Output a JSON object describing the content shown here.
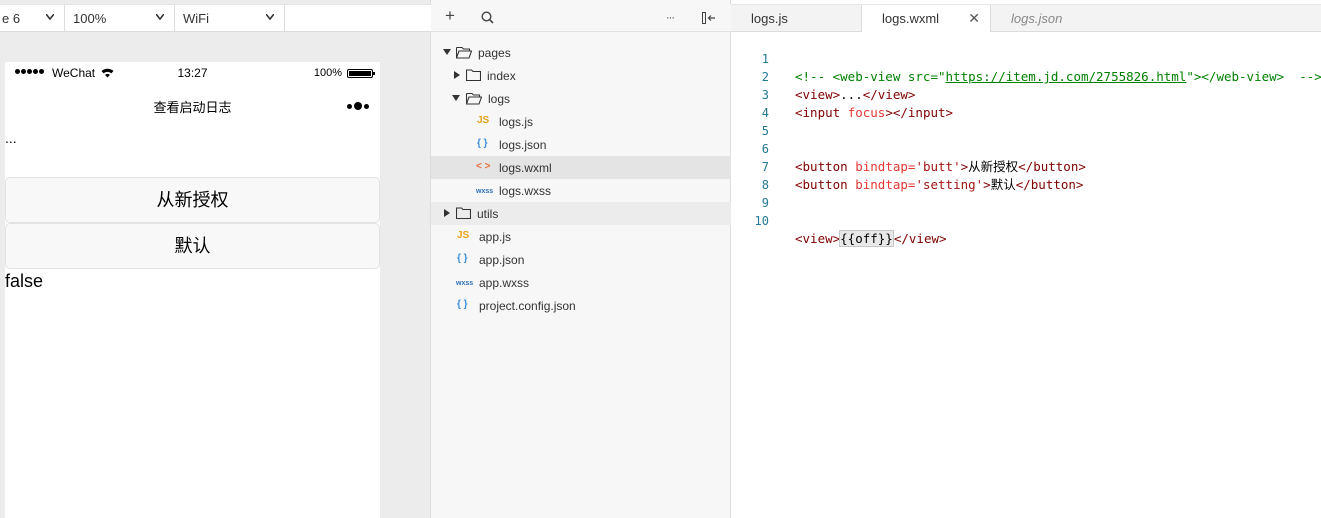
{
  "simulator": {
    "toolbar": {
      "device_select": "e 6",
      "zoom_select": "100%",
      "network_select": "WiFi"
    },
    "statusbar": {
      "carrier": "WeChat",
      "time": "13:27",
      "battery": "100%"
    },
    "navbar": {
      "title": "查看启动日志"
    },
    "page": {
      "ellipsis": "...",
      "reauth_button": "从新授权",
      "default_button": "默认",
      "off_value": "false"
    }
  },
  "file_tree": {
    "toolbar": {
      "add": "+",
      "more": "···"
    },
    "items": [
      {
        "label": "pages",
        "kind": "folder",
        "icon": "folder-open-icon"
      },
      {
        "label": "index",
        "kind": "folder",
        "icon": "folder-icon"
      },
      {
        "label": "logs",
        "kind": "folder",
        "icon": "folder-open-icon"
      },
      {
        "label": "logs.js",
        "kind": "file",
        "icon": "js-file-icon",
        "glyph": "JS"
      },
      {
        "label": "logs.json",
        "kind": "file",
        "icon": "json-file-icon",
        "glyph": "{ }"
      },
      {
        "label": "logs.wxml",
        "kind": "file",
        "icon": "wxml-file-icon",
        "glyph": "< >"
      },
      {
        "label": "logs.wxss",
        "kind": "file",
        "icon": "wxss-file-icon",
        "glyph": "wxss"
      },
      {
        "label": "utils",
        "kind": "folder",
        "icon": "folder-icon"
      },
      {
        "label": "app.js",
        "kind": "file",
        "icon": "js-file-icon",
        "glyph": "JS"
      },
      {
        "label": "app.json",
        "kind": "file",
        "icon": "json-file-icon",
        "glyph": "{ }"
      },
      {
        "label": "app.wxss",
        "kind": "file",
        "icon": "wxss-file-icon",
        "glyph": "wxss"
      },
      {
        "label": "project.config.json",
        "kind": "file",
        "icon": "json-file-icon",
        "glyph": "{ }"
      }
    ],
    "selected": "logs.wxml"
  },
  "editor": {
    "tabs": [
      {
        "label": "logs.js"
      },
      {
        "label": "logs.wxml",
        "active": true
      },
      {
        "label": "logs.json",
        "preview": true
      }
    ],
    "close_glyph": "✕",
    "line_numbers": [
      "1",
      "2",
      "3",
      "4",
      "5",
      "6",
      "7",
      "8",
      "9",
      "10"
    ],
    "code": {
      "l1_open": "<!-- <web-view src=\"",
      "l1_url": "https://item.jd.com/2755826.html",
      "l1_close": "\"></web-view>  -->",
      "l2_tag_open": "<view>",
      "l2_dots": "...",
      "l2_tag_close": "</view>",
      "l3_tag_open": "<input ",
      "l3_attr": "focus",
      "l3_tag_rest": "></input>",
      "l6_tag": "<button ",
      "l6_attr": "bindtap=",
      "l6_str": "'butt'",
      "l6_gt": ">",
      "l6_text": "从新授权",
      "l6_end": "</button>",
      "l7_tag": "<button ",
      "l7_attr": "bindtap=",
      "l7_str": "'setting'",
      "l7_gt": ">",
      "l7_text": "默认",
      "l7_end": "</button>",
      "l10_tag_open": "<view>",
      "l10_expr": "{{off}}",
      "l10_tag_close": "</view>"
    }
  }
}
